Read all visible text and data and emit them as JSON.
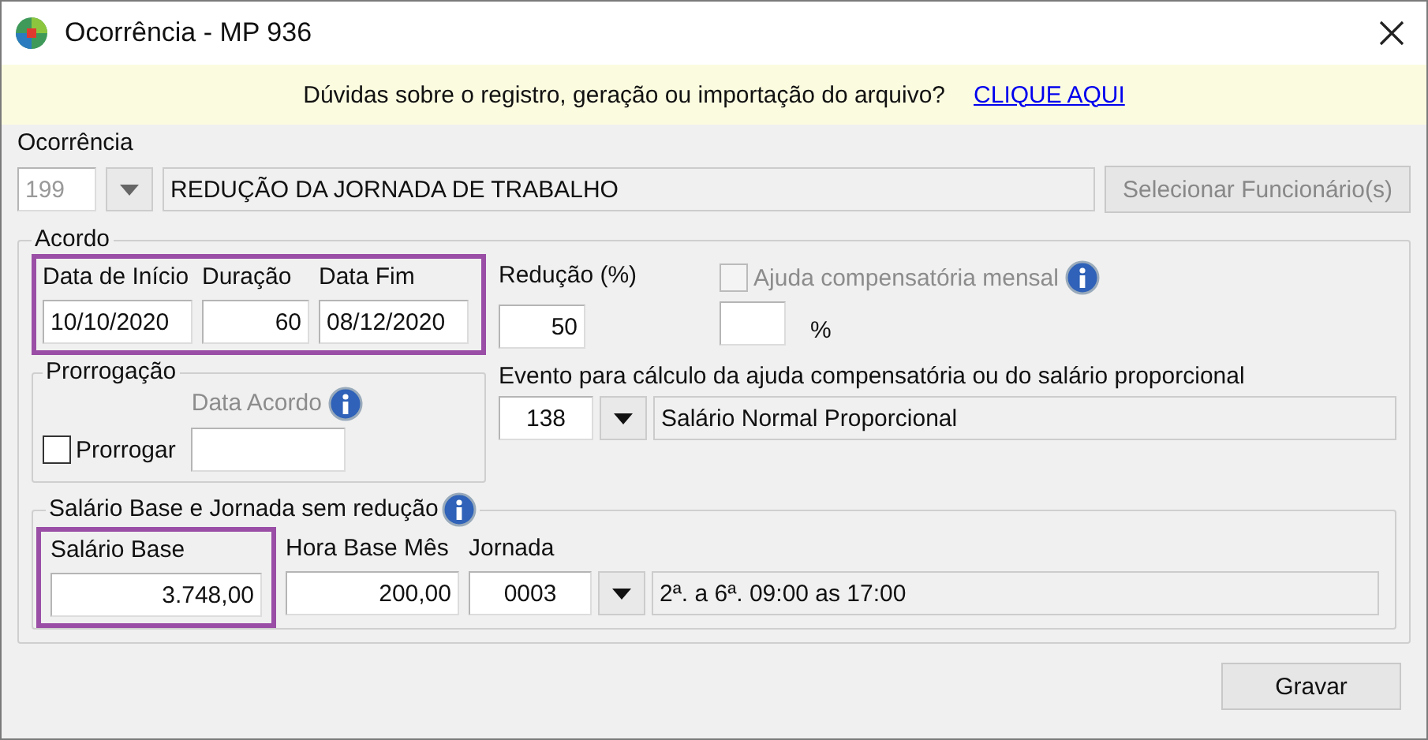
{
  "window": {
    "title": "Ocorrência - MP 936"
  },
  "banner": {
    "text": "Dúvidas sobre o registro, geração ou importação do arquivo?",
    "link": "CLIQUE AQUI"
  },
  "ocorrencia": {
    "label": "Ocorrência",
    "code": "199",
    "code_disabled": true,
    "description": "REDUÇÃO DA JORNADA DE TRABALHO",
    "button": {
      "label": "Selecionar Funcionário(s)",
      "disabled": true
    }
  },
  "acordo": {
    "legend": "Acordo",
    "period": {
      "highlighted": true,
      "fields": [
        {
          "label": "Data de Início",
          "value": "10/10/2020"
        },
        {
          "label": "Duração",
          "value": "60"
        },
        {
          "label": "Data Fim",
          "value": "08/12/2020"
        }
      ]
    },
    "reducao": {
      "label": "Redução (%)",
      "value": "50"
    },
    "ajuda": {
      "label": "Ajuda compensatória mensal",
      "checked": false,
      "disabled": true,
      "unit": "%"
    },
    "prorrogacao": {
      "legend": "Prorrogação",
      "checkbox": {
        "label": "Prorrogar",
        "checked": false
      },
      "data_acordo": {
        "label": "Data Acordo",
        "disabled": true
      }
    },
    "evento": {
      "label": "Evento para cálculo da ajuda compensatória ou do salário proporcional",
      "code": "138",
      "description": "Salário Normal Proporcional"
    }
  },
  "salario": {
    "legend": "Salário Base e Jornada sem redução",
    "base": {
      "label": "Salário Base",
      "value": "3.748,00",
      "highlighted": true
    },
    "hora": {
      "label": "Hora Base Mês",
      "value": "200,00"
    },
    "jornada": {
      "label": "Jornada",
      "code": "0003",
      "description": "2ª. a 6ª. 09:00 as 17:00"
    }
  },
  "buttons": [
    {
      "label": "Gravar"
    }
  ]
}
